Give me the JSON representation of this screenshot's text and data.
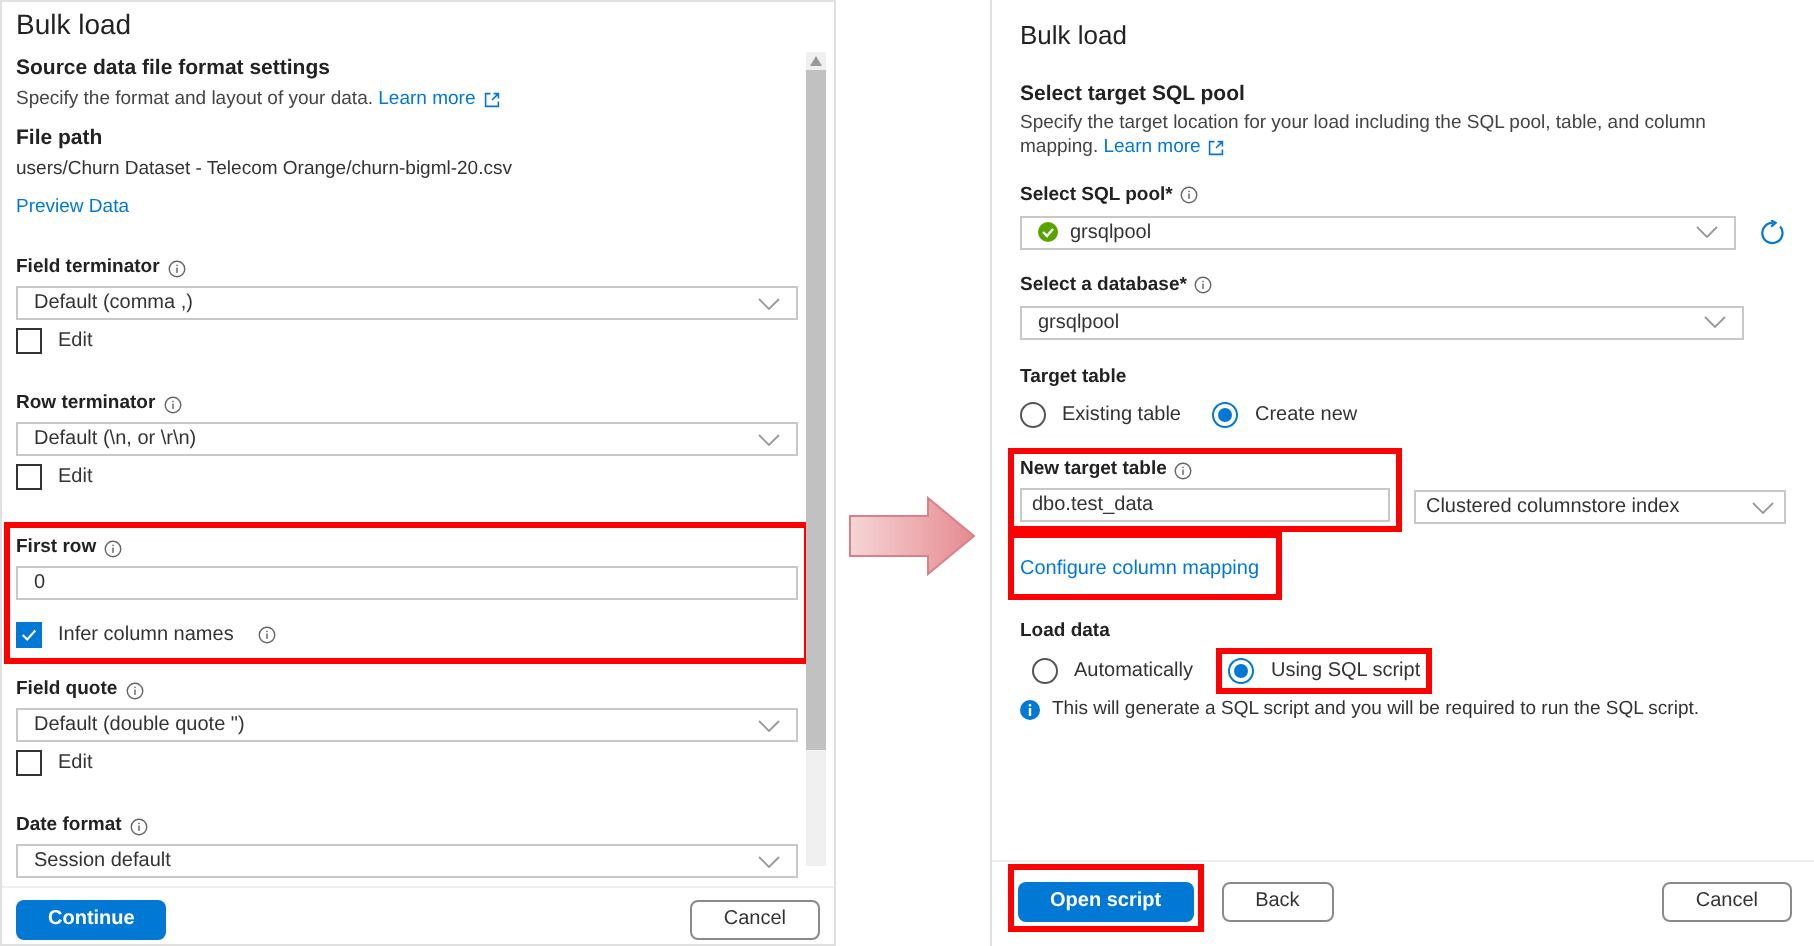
{
  "left_panel": {
    "title": "Bulk load",
    "section_title": "Source data file format settings",
    "description": "Specify the format and layout of your data.",
    "learn_more": "Learn more",
    "file_path_label": "File path",
    "file_path": "users/Churn Dataset - Telecom Orange/churn-bigml-20.csv",
    "preview_link": "Preview Data",
    "fields": [
      {
        "kind": "select",
        "label": "Field terminator",
        "value": "Default (comma ,)",
        "option": {
          "label": "Edit",
          "checked": false
        },
        "highlighted": false
      },
      {
        "kind": "select",
        "label": "Row terminator",
        "value": "Default (\\n, or \\r\\n)",
        "option": {
          "label": "Edit",
          "checked": false
        },
        "highlighted": false
      },
      {
        "kind": "text",
        "label": "First row",
        "value": "0",
        "option": {
          "label": "Infer column names",
          "checked": true,
          "info": true
        },
        "highlighted": true
      },
      {
        "kind": "select",
        "label": "Field quote",
        "value": "Default (double quote \")",
        "option": {
          "label": "Edit",
          "checked": false
        },
        "highlighted": false
      },
      {
        "kind": "select",
        "label": "Date format",
        "value": "Session default",
        "highlighted": false
      }
    ],
    "buttons": [
      {
        "label": "Continue",
        "kind": "primary"
      },
      {
        "label": "Cancel",
        "kind": "default"
      }
    ]
  },
  "right_panel": {
    "title": "Bulk load",
    "section_title": "Select target SQL pool",
    "description": "Specify the target location for your load including the SQL pool, table, and column mapping.",
    "learn_more": "Learn more",
    "pool": {
      "label": "Select SQL pool*",
      "value": "grsqlpool"
    },
    "database": {
      "label": "Select a database*",
      "value": "grsqlpool"
    },
    "target_table": {
      "label": "Target table",
      "options": [
        {
          "label": "Existing table",
          "selected": false
        },
        {
          "label": "Create new",
          "selected": true
        }
      ]
    },
    "new_table": {
      "label": "New target table",
      "value": "dbo.test_data",
      "highlighted": true
    },
    "index_select": {
      "value": "Clustered columnstore index"
    },
    "mapping_link": {
      "label": "Configure column mapping",
      "highlighted": true
    },
    "load_data": {
      "label": "Load data",
      "options": [
        {
          "label": "Automatically",
          "selected": false,
          "highlighted": false
        },
        {
          "label": "Using SQL script",
          "selected": true,
          "highlighted": true
        }
      ],
      "note": "This will generate a SQL script and you will be required to run the SQL script."
    },
    "buttons": [
      {
        "label": "Open script",
        "kind": "primary",
        "highlighted": true
      },
      {
        "label": "Back",
        "kind": "default",
        "highlighted": false
      },
      {
        "label": "Cancel",
        "kind": "default",
        "highlighted": false
      }
    ]
  }
}
